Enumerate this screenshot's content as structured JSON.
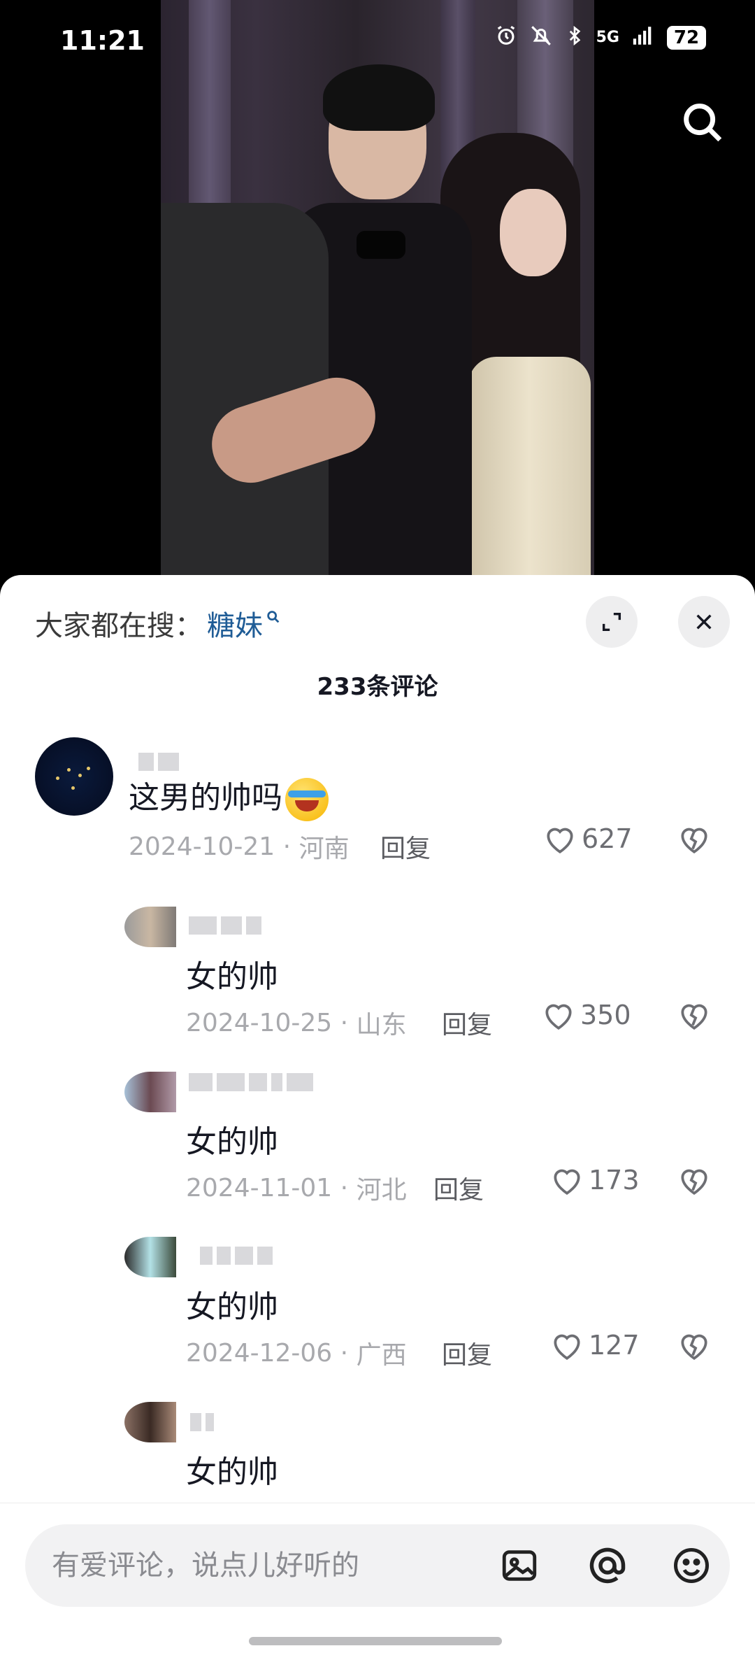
{
  "status_bar": {
    "time": "11:21",
    "network": "5G",
    "battery": "72",
    "icons": [
      "alarm-icon",
      "mute-icon",
      "bluetooth-icon",
      "signal-icon",
      "battery-icon"
    ]
  },
  "video": {
    "search_icon": "search-icon"
  },
  "comments_panel": {
    "trending_label": "大家都在搜：",
    "trending_term": "糖妹",
    "count_label": "233条评论",
    "reply_label": "回复",
    "comments": [
      {
        "text": "这男的帅吗",
        "date": "2024-10-21",
        "region": "河南",
        "likes": "627",
        "has_emoji": true
      },
      {
        "text": "女的帅",
        "date": "2024-10-25",
        "region": "山东",
        "likes": "350"
      },
      {
        "text": "女的帅",
        "date": "2024-11-01",
        "region": "河北",
        "likes": "173"
      },
      {
        "text": "女的帅",
        "date": "2024-12-06",
        "region": "广西",
        "likes": "127"
      },
      {
        "text": "女的帅"
      }
    ]
  },
  "input_bar": {
    "placeholder": "有爱评论，说点儿好听的",
    "icons": [
      "image-icon",
      "at-icon",
      "emoji-icon"
    ]
  },
  "colors": {
    "trending_term": "#1f5c96",
    "sheet_background": "#ffffff",
    "meta_text": "#a8a9ad"
  }
}
